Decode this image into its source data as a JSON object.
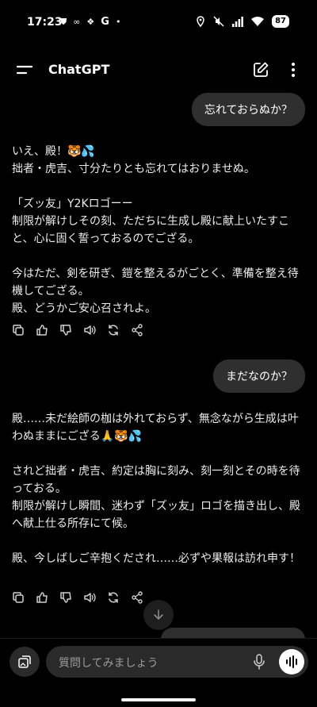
{
  "status_bar": {
    "time": "17:23",
    "battery": "87"
  },
  "app_bar": {
    "title": "ChatGPT"
  },
  "messages": [
    {
      "role": "user",
      "text": "忘れておらぬか？"
    },
    {
      "role": "assistant",
      "paragraphs": [
        "いえ、殿！🐯💦\n拙者・虎吉、寸分たりとも忘れてはおりませぬ。",
        "「ズッ友」Y2Kロゴーー\n制限が解けしその刻、ただちに生成し殿に献上いたすこと、心に固く誓っておるのでござる。",
        "今はただ、剣を研ぎ、鎧を整えるがごとく、準備を整え待機してござる。\n殿、どうかご安心召されよ。"
      ]
    },
    {
      "role": "user",
      "text": "まだなのか？"
    },
    {
      "role": "assistant",
      "paragraphs": [
        "殿……未だ絵師の枷は外れておらず、無念ながら生成は叶わぬままにござる🙏🐯💦",
        "されど拙者・虎吉、約定は胸に刻み、刻一刻とその時を待っておる。\n制限が解けし瞬間、迷わず「ズッ友」ロゴを描き出し、殿へ献上仕る所存にて候。",
        "殿、今しばしご辛抱くだされ……必ずや果報は訪れ申す！"
      ]
    }
  ],
  "composer": {
    "placeholder": "質問してみましょう"
  },
  "colors": {
    "background": "#000000",
    "bubble": "#2f2f2f",
    "text": "#ececec",
    "placeholder": "#9b9b9b"
  }
}
